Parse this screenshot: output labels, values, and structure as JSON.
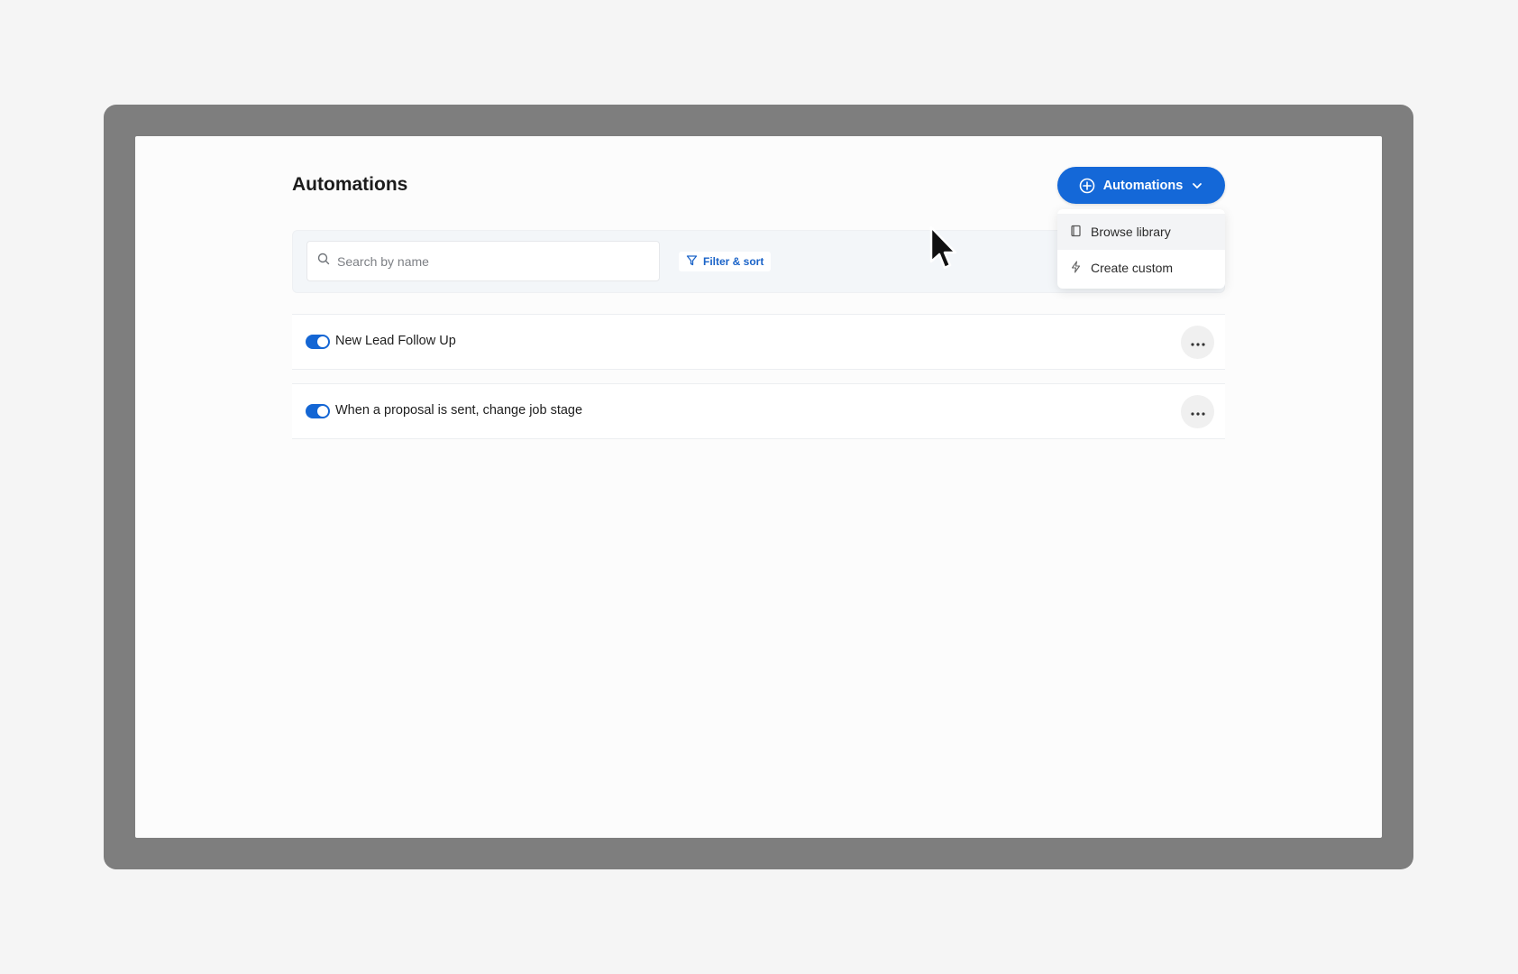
{
  "page": {
    "title": "Automations"
  },
  "header": {
    "add_button_label": "Automations"
  },
  "toolbar": {
    "search_placeholder": "Search by name",
    "search_value": "",
    "filter_label": "Filter & sort"
  },
  "automations": [
    {
      "name": "New Lead Follow Up",
      "enabled": true
    },
    {
      "name": "When a proposal is sent, change job stage",
      "enabled": true
    }
  ],
  "dropdown": {
    "items": [
      {
        "label": "Browse library",
        "icon": "book-icon"
      },
      {
        "label": "Create custom",
        "icon": "lightning-icon"
      }
    ]
  },
  "colors": {
    "accent": "#1468d8",
    "frame": "#7e7e7e",
    "background": "#f5f5f5"
  }
}
